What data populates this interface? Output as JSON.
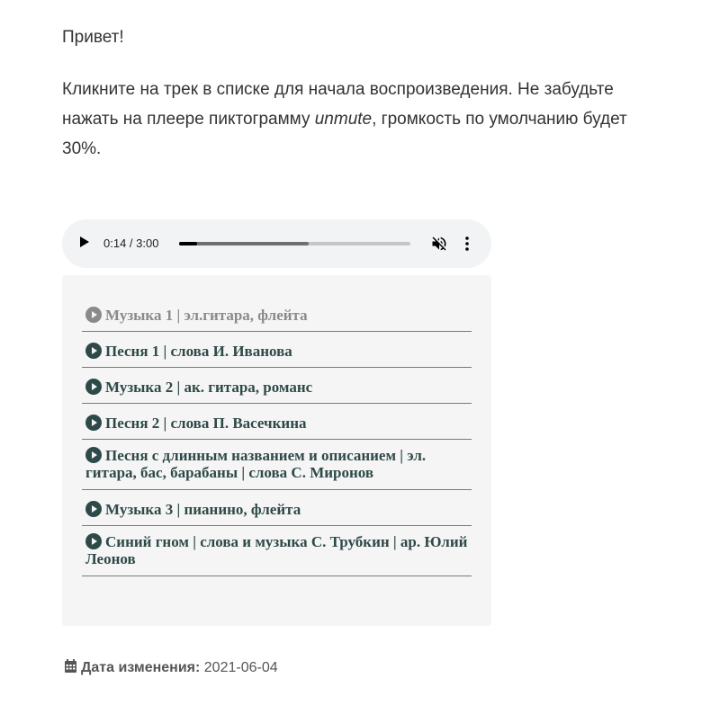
{
  "greeting": "Привет!",
  "intro": {
    "before": "Кликните на трек в списке для начала воспроизведения. Не забудьте нажать на плеере пиктограмму ",
    "em": "unmute",
    "after": ", громкость по умолчанию будет 30%."
  },
  "player": {
    "time": "0:14 / 3:00",
    "played_fraction": 0.0778,
    "buffered_fraction": 0.56,
    "play_icon": "play-icon",
    "mute_icon": "volume-muted-icon",
    "menu_icon": "more-vert-icon"
  },
  "playlist": {
    "tracks": [
      {
        "label": "Музыка 1 | эл.гитара, флейта"
      },
      {
        "label": "Песня 1 | слова И. Иванова"
      },
      {
        "label": "Музыка 2 | ак. гитара, романс"
      },
      {
        "label": "Песня 2 | слова П. Васечкина"
      },
      {
        "label": "Песня с длинным названием и описанием | эл. гитара, бас, барабаны | слова С. Миронов"
      },
      {
        "label": "Музыка 3 | пианино, флейта"
      },
      {
        "label": "Синий гном | слова и музыка С. Трубкин | ар. Юлий Леонов"
      }
    ],
    "track_icon": "play-circle-icon"
  },
  "meta": {
    "label": "Дата изменения:",
    "value": "2021-06-04",
    "icon": "calendar-icon"
  },
  "colors": {
    "text": "#333333",
    "track": "#2e4a48",
    "track_played": "#8a8a8a",
    "player_bg": "#f1f3f4",
    "playlist_bg": "#f5f5f5"
  }
}
